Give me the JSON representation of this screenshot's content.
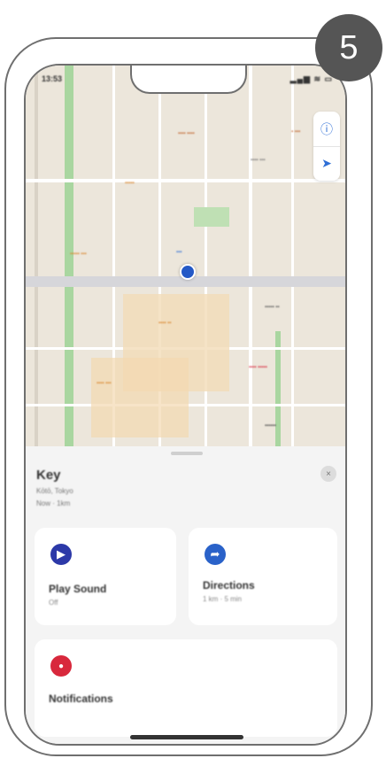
{
  "step_badge": "5",
  "status": {
    "time": "13:53",
    "icons": "▂▄▆ ≋ ▭"
  },
  "map": {
    "controls": [
      {
        "icon": "info-icon",
        "glyph": "ⓘ"
      },
      {
        "icon": "location-arrow-icon",
        "glyph": "➤"
      }
    ],
    "pin_icon": "map-pin-icon"
  },
  "sheet": {
    "item_name": "Key",
    "item_location": "Kōtō, Tokyo",
    "item_time": "Now · 1km",
    "close_glyph": "×",
    "actions": [
      {
        "title": "Play Sound",
        "subtitle": "Off",
        "icon": "play-icon",
        "glyph": "▶",
        "color": "#2c39a8"
      },
      {
        "title": "Directions",
        "subtitle": "1 km · 5 min",
        "icon": "car-icon",
        "glyph": "➦",
        "color": "#2a62c9"
      },
      {
        "title": "Notifications",
        "subtitle": "",
        "icon": "bell-icon",
        "glyph": "●",
        "color": "#d8283c"
      }
    ]
  },
  "colors": {
    "accent": "#2f6fd6",
    "badge": "#555555",
    "danger": "#d8283c"
  }
}
